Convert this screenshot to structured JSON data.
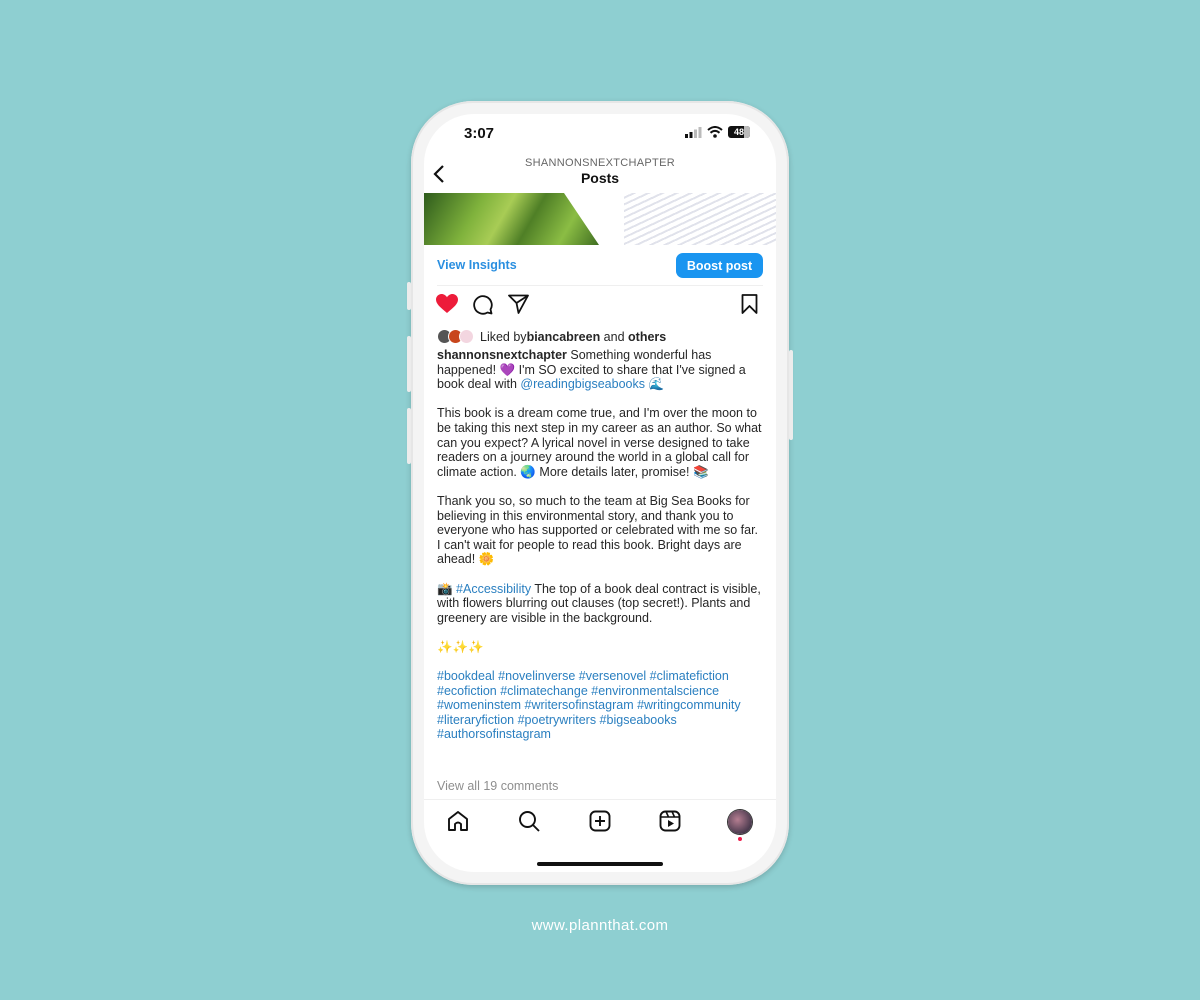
{
  "status_bar": {
    "time": "3:07",
    "battery": "48"
  },
  "header": {
    "username": "SHANNONSNEXTCHAPTER",
    "title": "Posts"
  },
  "post_actions": {
    "view_insights": "View Insights",
    "boost_post": "Boost post"
  },
  "likes": {
    "prefix": "Liked by ",
    "user": "biancabreen",
    "middle": " and ",
    "others": "others"
  },
  "caption": {
    "username": "shannonsnextchapter",
    "p1": " Something wonderful has happened! 💜 I'm SO excited to share that I've signed a book deal with ",
    "p1_mention": "@readingbigseabooks",
    "p1_end": " 🌊",
    "p2": "This book is a dream come true, and I'm over the moon to be taking this next step in my career as an author. So what can you expect? A lyrical novel in verse designed to take readers on a journey around the world in a global call for climate action. 🌏 More details later, promise! 📚",
    "p3": "Thank you so, so much to the team at Big Sea Books for believing in this environmental story, and thank you to everyone who has supported or celebrated with me so far. I can't wait for people to read this book. Bright days are ahead! 🌼",
    "p4_icon": "📸 ",
    "p4_tag": "#Accessibility",
    "p4": " The top of a book deal contract is visible, with flowers blurring out clauses (top secret!). Plants and greenery are visible in the background.",
    "p5": "✨✨✨",
    "hashtags": "#bookdeal #novelinverse #versenovel #climatefiction #ecofiction #climatechange #environmentalscience #womeninstem #writersofinstagram #writingcommunity #literaryfiction #poetrywriters #bigseabooks #authorsofinstagram"
  },
  "comments": {
    "label": "View all 19 comments"
  },
  "tabbar": {
    "items": [
      "home",
      "search",
      "create",
      "reels",
      "profile"
    ]
  },
  "footer": {
    "url": "www.plannthat.com"
  },
  "colors": {
    "background": "#8ecfd1",
    "accent": "#1a95f0",
    "like": "#ed1c3a",
    "link": "#2a7fc0"
  }
}
